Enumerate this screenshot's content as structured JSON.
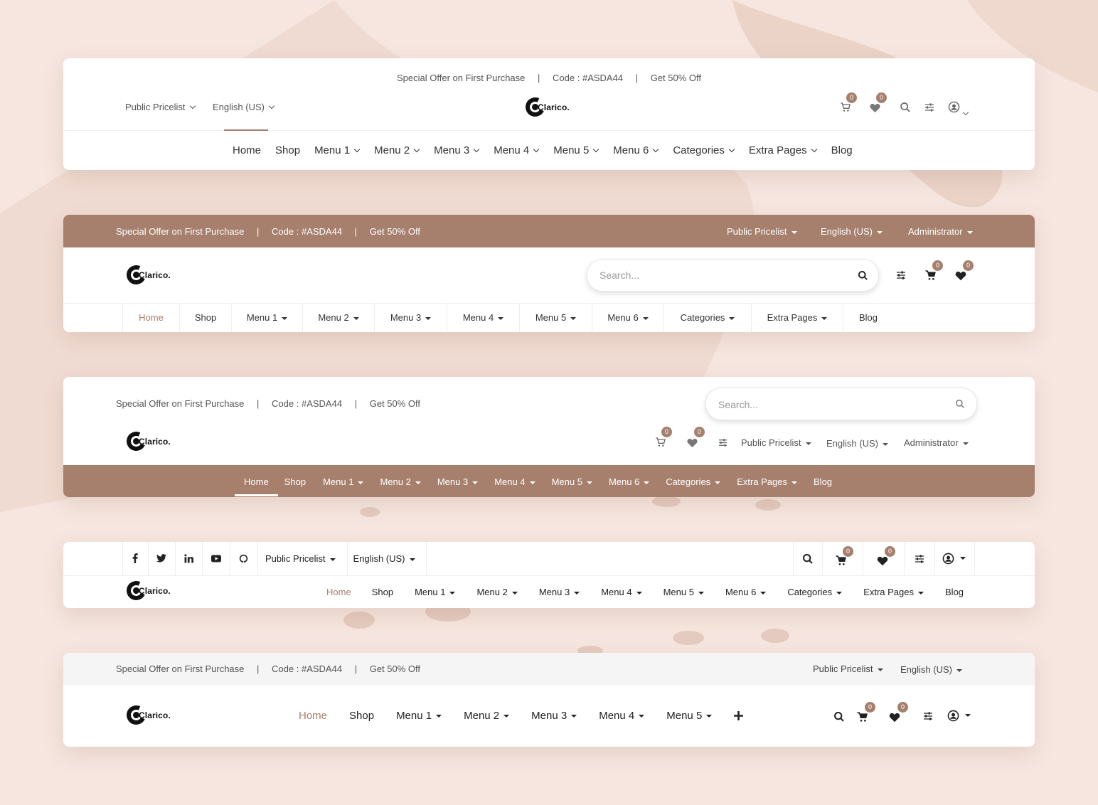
{
  "brand": {
    "logo_text": "Clarico.",
    "accent_color": "#a6806d"
  },
  "offer": {
    "text": "Special Offer on First Purchase",
    "code": "Code : #ASDA44",
    "discount": "Get 50% Off"
  },
  "common": {
    "pricelist": "Public Pricelist",
    "language": "English (US)",
    "admin": "Administrator",
    "search_placeholder": "Search...",
    "badge_count": "0"
  },
  "menu": [
    "Home",
    "Shop",
    "Menu 1",
    "Menu 2",
    "Menu 3",
    "Menu 4",
    "Menu 5",
    "Menu 6",
    "Categories",
    "Extra Pages",
    "Blog"
  ],
  "icons": [
    "cart-icon",
    "heart-icon",
    "search-icon",
    "sliders-icon",
    "user-icon",
    "plus-icon",
    "facebook-icon",
    "twitter-icon",
    "linkedin-icon",
    "youtube-icon",
    "github-icon"
  ]
}
